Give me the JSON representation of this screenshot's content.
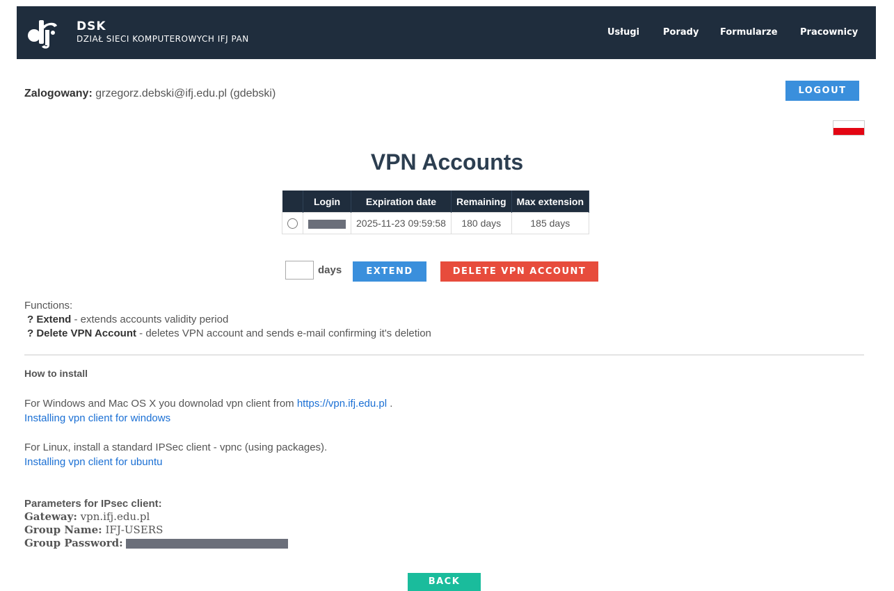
{
  "header": {
    "brand_title": "DSK",
    "brand_subtitle": "DZIAŁ SIECI KOMPUTEROWYCH IFJ PAN",
    "logo_icon": "ifj-logo-icon",
    "nav": [
      "Usługi",
      "Porady",
      "Formularze",
      "Pracownicy"
    ]
  },
  "session": {
    "label": "Zalogowany:",
    "user": "grzegorz.debski@ifj.edu.pl (gdebski)",
    "logout_label": "LOGOUT",
    "flag_icon": "polish-flag-icon"
  },
  "page_title": "VPN Accounts",
  "table": {
    "headers": [
      "",
      "Login",
      "Expiration date",
      "Remaining",
      "Max extension"
    ],
    "rows": [
      {
        "expiration": "2025-11-23 09:59:58",
        "remaining": "180 days",
        "max_extension": "185 days"
      }
    ]
  },
  "actions": {
    "days_value": "",
    "days_label": "days",
    "extend_label": "EXTEND",
    "delete_label": "DELETE VPN ACCOUNT"
  },
  "functions": {
    "heading": "Functions:",
    "items": [
      {
        "name": "? Extend",
        "desc": " - extends accounts validity period"
      },
      {
        "name": "? Delete VPN Account",
        "desc": " - deletes VPN account and sends e-mail confirming it's deletion"
      }
    ]
  },
  "install": {
    "heading": "How to install",
    "windows_text": "For Windows and Mac OS X you downolad vpn client from ",
    "windows_link": "https://vpn.ifj.edu.pl",
    "windows_after": " .",
    "windows_guide": "Installing vpn client for windows",
    "linux_text": "For Linux, install a standard IPSec client - vpnc (using packages).",
    "linux_guide": "Installing vpn client for ubuntu"
  },
  "params": {
    "heading": "Parameters for IPsec client:",
    "gateway_label": "Gateway:",
    "gateway_value": "vpn.ifj.edu.pl",
    "group_label": "Group Name:",
    "group_value": "IFJ-USERS",
    "password_label": "Group Password:"
  },
  "back_label": "BACK",
  "colors": {
    "navbar": "#1f2d3d",
    "primary": "#3a8fdc",
    "danger": "#e74c3c",
    "success": "#1abc9c",
    "link": "#1a6fd4"
  }
}
